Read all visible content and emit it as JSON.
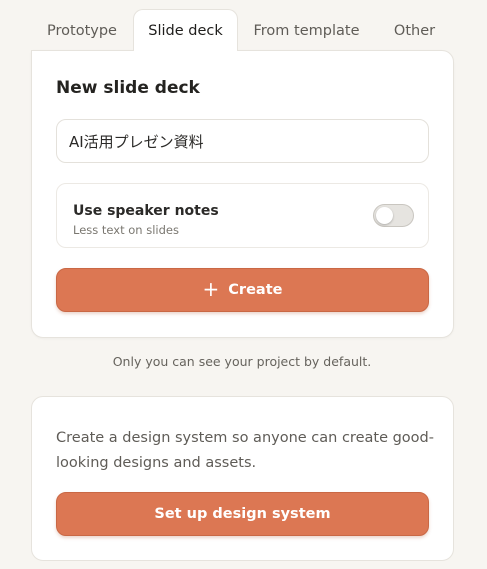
{
  "tabs": [
    {
      "label": "Prototype",
      "active": false
    },
    {
      "label": "Slide deck",
      "active": true
    },
    {
      "label": "From template",
      "active": false
    },
    {
      "label": "Other",
      "active": false
    }
  ],
  "new_deck": {
    "title": "New slide deck",
    "name_value": "AI活用プレゼン資料",
    "speaker_notes": {
      "label": "Use speaker notes",
      "sublabel": "Less text on slides",
      "enabled": false
    },
    "create_icon": "plus-icon",
    "create_glyph": "+",
    "create_label": "Create"
  },
  "privacy_note": "Only you can see your project by default.",
  "design_system": {
    "text": "Create a design system so anyone can create good-looking designs and assets.",
    "button_label": "Set up design system"
  },
  "colors": {
    "accent": "#dc7753",
    "background": "#f7f5f1",
    "card": "#ffffff"
  }
}
